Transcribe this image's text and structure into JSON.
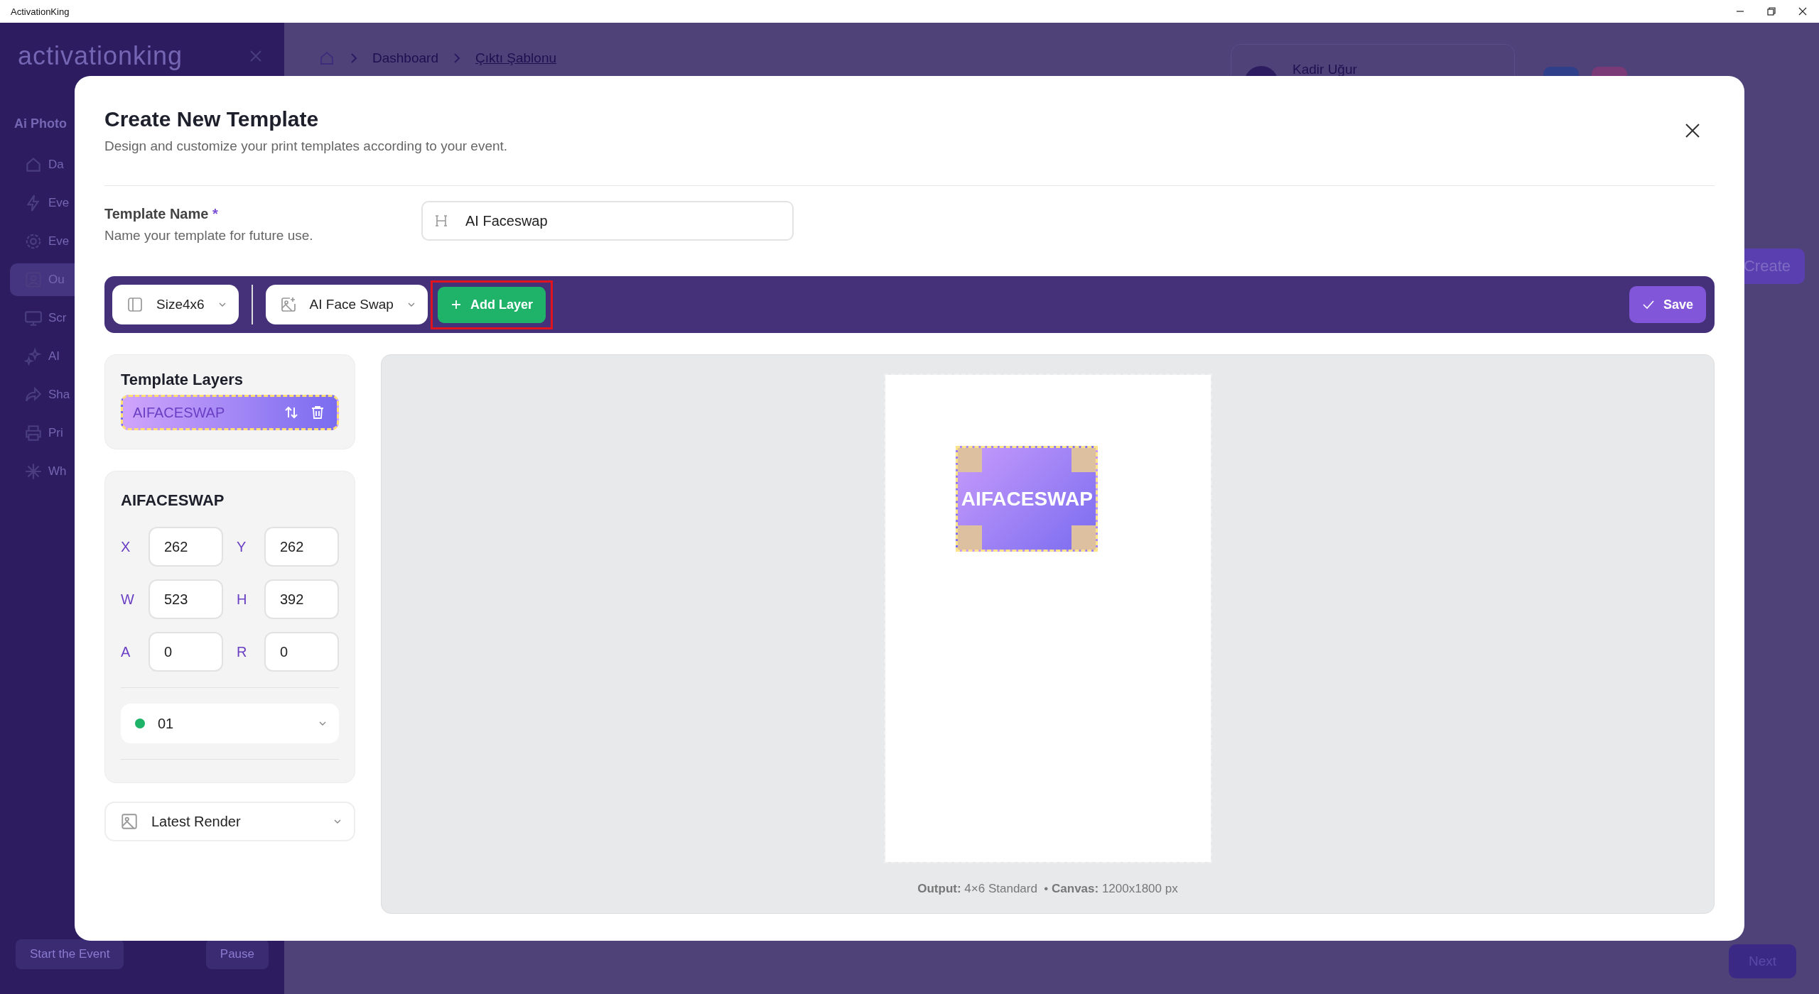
{
  "window": {
    "title": "ActivationKing"
  },
  "background": {
    "logo": "activationking",
    "sidebar_title": "Ai Photo",
    "sidebar_items": [
      {
        "label": "Da",
        "selected": false
      },
      {
        "label": "Eve",
        "selected": false
      },
      {
        "label": "Eve",
        "selected": false
      },
      {
        "label": "Ou",
        "selected": true
      },
      {
        "label": "Scr",
        "selected": false
      },
      {
        "label": "AI",
        "selected": false
      },
      {
        "label": "Sha",
        "selected": false
      },
      {
        "label": "Pri",
        "selected": false
      },
      {
        "label": "Wh",
        "selected": false
      }
    ],
    "sidebar_buttons": [
      "Start the Event",
      "Pause"
    ],
    "breadcrumb": [
      "Dashboard",
      "Çıktı Şablonu"
    ],
    "user_name": "Kadir Uğur",
    "create_button": "Create",
    "next_button": "Next"
  },
  "modal": {
    "title": "Create New Template",
    "subtitle": "Design and customize your print templates according to your event.",
    "template_name": {
      "label": "Template Name",
      "required": "*",
      "hint": "Name your template for future use.",
      "value": "AI Faceswap"
    },
    "toolbar": {
      "size": "Size4x6",
      "layer_type": "AI Face Swap",
      "add_layer": {
        "label": "Add Layer",
        "highlighted": true
      },
      "save": "Save"
    },
    "layers_panel": {
      "title": "Template Layers",
      "layers": [
        {
          "name": "AIFACESWAP",
          "selected": true
        }
      ]
    },
    "properties": {
      "title": "AIFACESWAP",
      "fields": [
        {
          "label": "X",
          "value": "262"
        },
        {
          "label": "Y",
          "value": "262"
        },
        {
          "label": "W",
          "value": "523"
        },
        {
          "label": "H",
          "value": "392"
        },
        {
          "label": "A",
          "value": "0"
        },
        {
          "label": "R",
          "value": "0"
        }
      ],
      "slot": {
        "label": "01",
        "color": "#1fb36a"
      }
    },
    "render_select": "Latest Render",
    "canvas": {
      "layer_label": "AIFACESWAP",
      "caption": "**Output:** 4×6 Standard  • **Canvas:** 1200x1800 px"
    }
  }
}
